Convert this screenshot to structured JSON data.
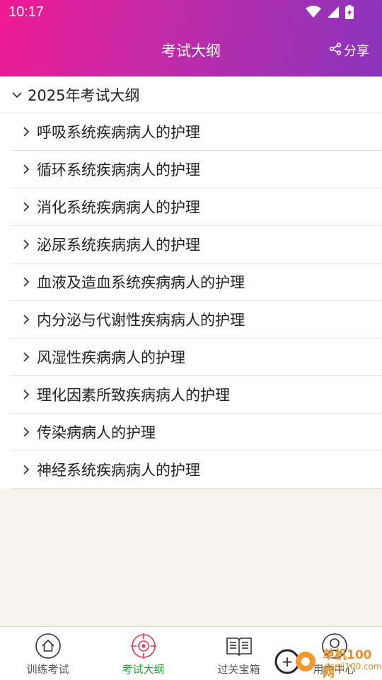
{
  "status": {
    "time": "10:17"
  },
  "header": {
    "title": "考试大纲",
    "share_label": "分享"
  },
  "outline": {
    "group_title": "2025年考试大纲",
    "items": [
      "呼吸系统疾病病人的护理",
      "循环系统疾病病人的护理",
      "消化系统疾病病人的护理",
      "泌尿系统疾病病人的护理",
      "血液及造血系统疾病病人的护理",
      "内分泌与代谢性疾病病人的护理",
      "风湿性疾病病人的护理",
      "理化因素所致疾病病人的护理",
      "传染病病人的护理",
      "神经系统疾病病人的护理"
    ]
  },
  "tabs": [
    {
      "label": "训练考试",
      "icon": "home-icon",
      "active": false
    },
    {
      "label": "考试大纲",
      "icon": "target-icon",
      "active": true
    },
    {
      "label": "过关宝箱",
      "icon": "book-icon",
      "active": false
    },
    {
      "label": "用户中心",
      "icon": "user-icon",
      "active": false
    }
  ],
  "colors": {
    "accent_pink": "#ee1a93",
    "accent_purple": "#8a35bd",
    "active_tab": "#2a9d3a"
  },
  "watermark": {
    "text1": "单机100网",
    "text2": "danji100.com"
  }
}
